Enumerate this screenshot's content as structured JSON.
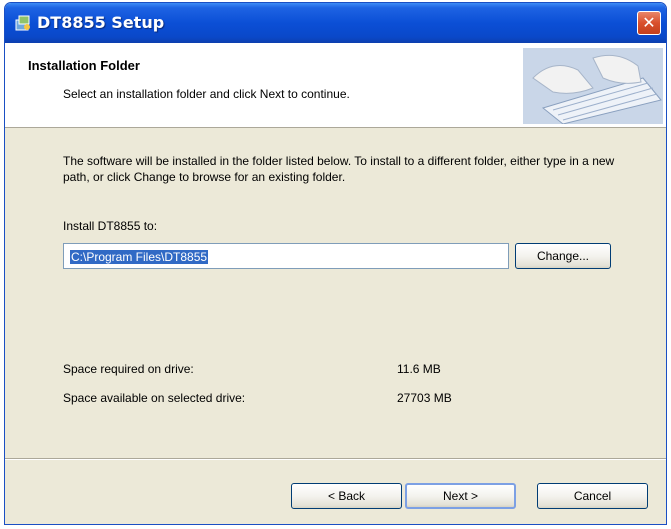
{
  "window": {
    "title": "DT8855 Setup",
    "close_glyph": "✕"
  },
  "header": {
    "title": "Installation Folder",
    "subtitle": "Select an installation folder and click Next to continue."
  },
  "body": {
    "description": "The software will be installed in the folder listed below. To install to a different folder, either type in a new path, or click Change to browse for an existing folder.",
    "install_label": "Install DT8855 to:",
    "path_value": "C:\\Program Files\\DT8855",
    "change_label": "Change..."
  },
  "space": {
    "required_label": "Space required on drive:",
    "required_value": "11.6 MB",
    "available_label": "Space available on selected drive:",
    "available_value": "27703 MB"
  },
  "footer": {
    "back_label": "< Back",
    "next_label": "Next >",
    "cancel_label": "Cancel"
  },
  "icons": {
    "title_icon": "installer-icon",
    "header_art": "keyboard-typing-image"
  },
  "colors": {
    "titlebar": "#0b4fd6",
    "close_button": "#d9502d",
    "selection": "#316ac5",
    "dialog_face": "#ece9d8"
  }
}
